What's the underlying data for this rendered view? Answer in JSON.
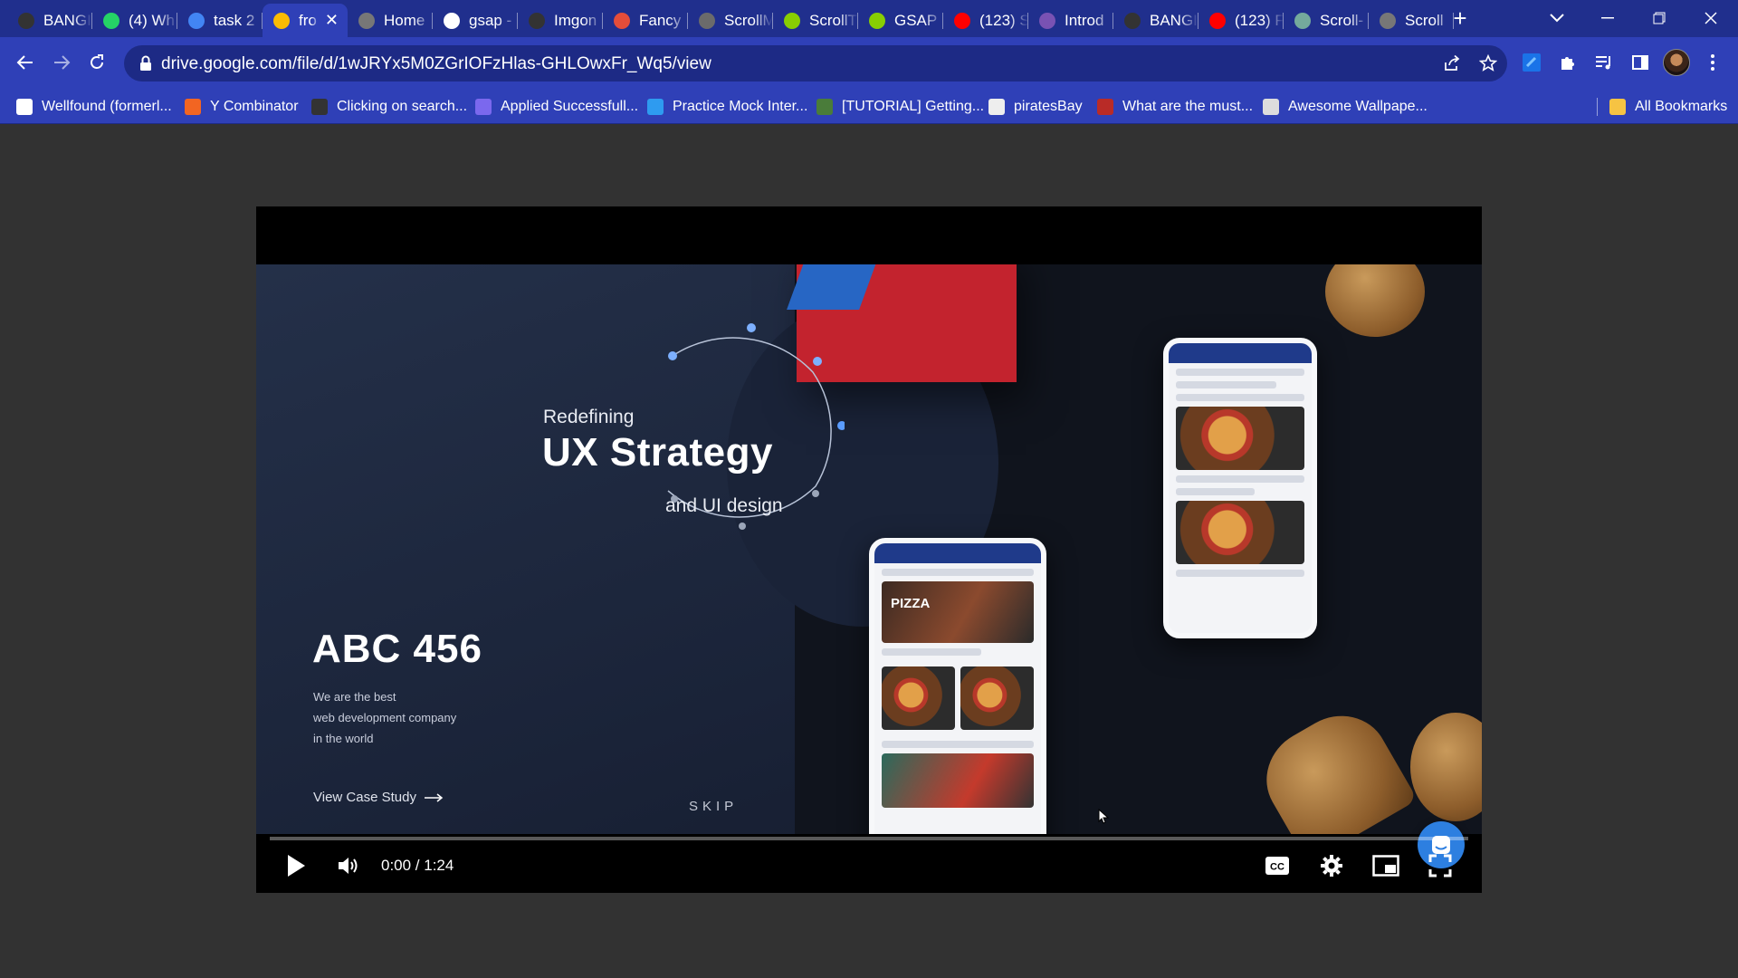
{
  "tabs": [
    {
      "title": "BANGI",
      "icon": "github-icon",
      "color": "#333333"
    },
    {
      "title": "(4) Wh",
      "icon": "whatsapp-icon",
      "color": "#25d366"
    },
    {
      "title": "task 2",
      "icon": "google-docs-icon",
      "color": "#4285f4"
    },
    {
      "title": "fro",
      "icon": "google-drive-icon",
      "color": "#fbbc04",
      "active": true
    },
    {
      "title": "Home",
      "icon": "globe-icon",
      "color": "#777777"
    },
    {
      "title": "gsap -",
      "icon": "code-icon",
      "color": "#ffffff"
    },
    {
      "title": "Imgon",
      "icon": "github-icon",
      "color": "#333333"
    },
    {
      "title": "Fancy",
      "icon": "fancy-icon",
      "color": "#e44d3a"
    },
    {
      "title": "ScrollM",
      "icon": "scroll-icon",
      "color": "#6b6b6b"
    },
    {
      "title": "ScrollT",
      "icon": "gsap-icon",
      "color": "#88ce02"
    },
    {
      "title": "GSAP",
      "icon": "gsap-icon",
      "color": "#88ce02"
    },
    {
      "title": "(123) S",
      "icon": "youtube-icon",
      "color": "#ff0000"
    },
    {
      "title": "Introd",
      "icon": "bootstrap-icon",
      "color": "#7952b3"
    },
    {
      "title": "BANGI",
      "icon": "github-icon",
      "color": "#333333"
    },
    {
      "title": "(123) F",
      "icon": "youtube-icon",
      "color": "#ff0000"
    },
    {
      "title": "Scroll-",
      "icon": "chatgpt-icon",
      "color": "#74aa9c"
    },
    {
      "title": "Scroll",
      "icon": "globe-icon",
      "color": "#777777"
    }
  ],
  "address_bar": {
    "url": "drive.google.com/file/d/1wJRYx5M0ZGrIOFzHlas-GHLOwxFr_Wq5/view"
  },
  "bookmarks": [
    {
      "label": "Wellfound (formerl...",
      "icon": "wellfound-icon",
      "color": "#ffffff"
    },
    {
      "label": "Y Combinator",
      "icon": "ycombinator-icon",
      "color": "#f26522"
    },
    {
      "label": "Clicking on search...",
      "icon": "github-icon",
      "color": "#333333"
    },
    {
      "label": "Applied Successfull...",
      "icon": "check-icon",
      "color": "#7b68ee"
    },
    {
      "label": "Practice Mock Inter...",
      "icon": "check-circle-icon",
      "color": "#2e9bf0"
    },
    {
      "label": "[TUTORIAL] Getting...",
      "icon": "image-icon",
      "color": "#4a7c3a"
    },
    {
      "label": "piratesBay",
      "icon": "pirate-icon",
      "color": "#eeeeee"
    },
    {
      "label": "What are the must...",
      "icon": "quora-icon",
      "color": "#b92b27"
    },
    {
      "label": "Awesome Wallpape...",
      "icon": "wallpaper-icon",
      "color": "#dddddd"
    }
  ],
  "all_bookmarks": "All Bookmarks",
  "video": {
    "heading_pre": "Redefining",
    "heading_main": "UX Strategy",
    "heading_sub": "and UI design",
    "brand": "ABC 456",
    "tagline": [
      "We are the best",
      "web development company",
      "in the world"
    ],
    "cta": "View Case Study",
    "skip": "SKIP",
    "banner_text": "PIZZA"
  },
  "player": {
    "time": "0:00 / 1:24",
    "progress": 0.0
  }
}
